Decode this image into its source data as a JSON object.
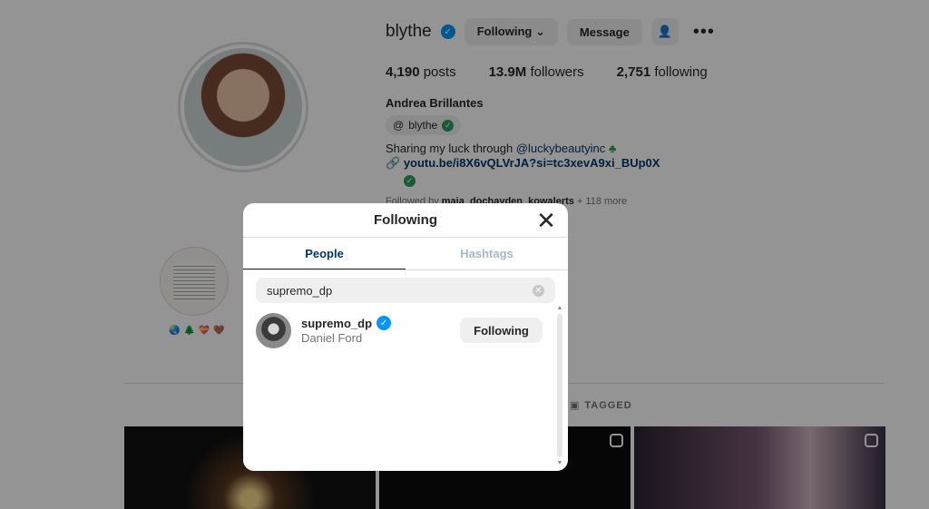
{
  "profile": {
    "username": "blythe",
    "following_label": "Following",
    "message_label": "Message",
    "posts_count": "4,190",
    "posts_label": "posts",
    "followers_count": "13.9M",
    "followers_label": "followers",
    "following_count": "2,751",
    "following_stat_label": "following",
    "full_name": "Andrea Brillantes",
    "threads_handle": "blythe",
    "bio_text": "Sharing my luck through ",
    "bio_mention": "@luckybeautyinc",
    "bio_link": "youtu.be/i8X6vQLVrJA?si=tc3xevA9xi_BUp0X",
    "followed_by_prefix": "Followed by ",
    "followed_by_names": "maja_dochayden_kowalerts",
    "followed_by_more": " + 118 more",
    "tagged_label": "TAGGED"
  },
  "modal": {
    "title": "Following",
    "tabs": [
      {
        "label": "People",
        "active": true
      },
      {
        "label": "Hashtags",
        "active": false
      }
    ],
    "search": {
      "value": "supremo_dp"
    },
    "results": [
      {
        "username": "supremo_dp",
        "full_name": "Daniel Ford",
        "verified": true,
        "button_label": "Following"
      }
    ]
  },
  "colors": {
    "accent_blue": "#0095f6",
    "link_blue": "#00376b",
    "overlay": "rgba(0,0,0,0.42)"
  }
}
